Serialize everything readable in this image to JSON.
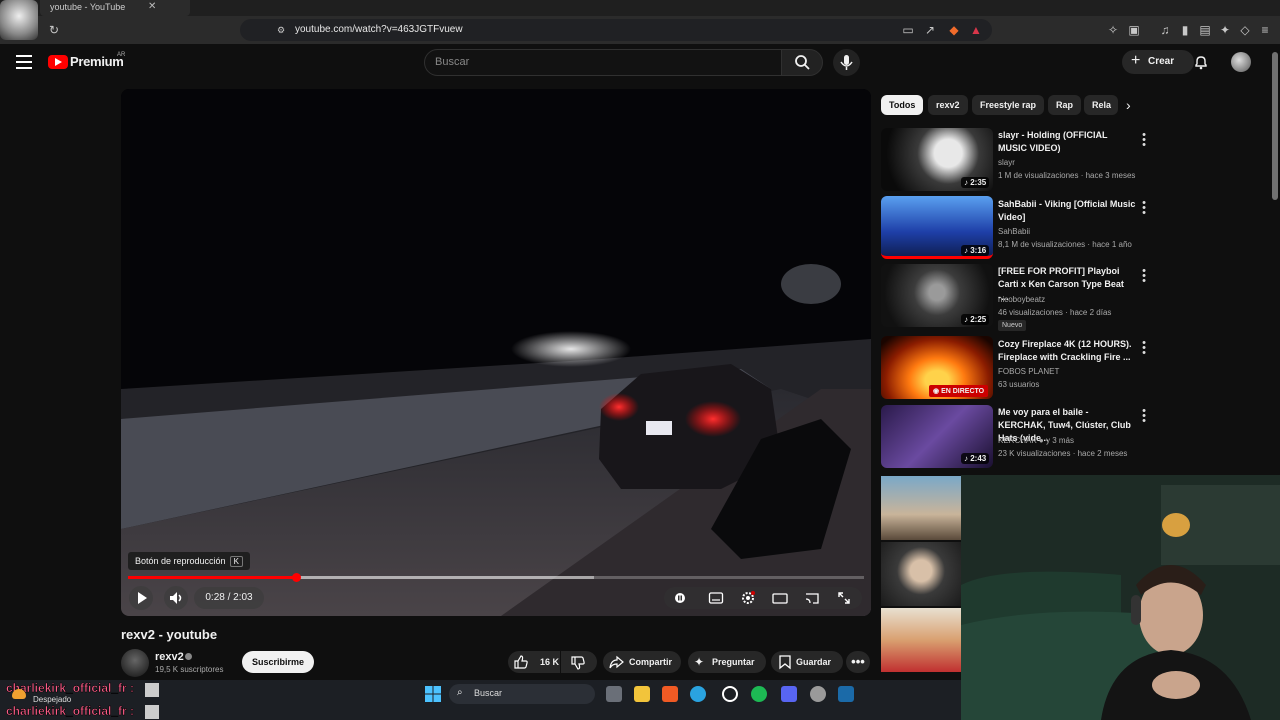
{
  "browser": {
    "tab_title": "youtube - YouTube",
    "url": "youtube.com/watch?v=463JGTFvuew"
  },
  "header": {
    "logo_text": "Premium",
    "logo_region": "AR",
    "search_placeholder": "Buscar",
    "create_label": "Crear"
  },
  "player": {
    "tooltip_label": "Botón de reproducción",
    "tooltip_key": "K",
    "time_display": "0:28 / 2:03",
    "progress_fraction": 0.228,
    "buffered_fraction": 0.633
  },
  "video": {
    "title": "rexv2 - youtube",
    "channel": "rexv2",
    "subscribers": "19,5 K suscriptores",
    "subscribe_label": "Suscribirme",
    "likes": "16 K",
    "share_label": "Compartir",
    "ask_label": "Preguntar",
    "save_label": "Guardar"
  },
  "chips": [
    "Todos",
    "rexv2",
    "Freestyle rap",
    "Rap",
    "Rela"
  ],
  "recommendations": [
    {
      "title": "slayr - Holding (OFFICIAL MUSIC VIDEO)",
      "channel": "slayr",
      "meta": "1 M de visualizaciones · hace 3 meses",
      "duration": "2:35"
    },
    {
      "title": "SahBabii - Viking [Official Music Video]",
      "channel": "SahBabii",
      "meta": "8,1 M de visualizaciones · hace 1 año",
      "duration": "3:16"
    },
    {
      "title": "[FREE FOR PROFIT] Playboi Carti x Ken Carson Type Beat -...",
      "channel": "nicoboybeatz",
      "meta": "46 visualizaciones · hace 2 días",
      "duration": "2:25",
      "badge": "Nuevo"
    },
    {
      "title": "Cozy Fireplace 4K (12 HOURS). Fireplace with Crackling Fire ...",
      "channel": "FOBOS PLANET",
      "meta": "63 usuarios",
      "live_label": "EN DIRECTO"
    },
    {
      "title": "Me voy para el baile - KERCHAK, Tuw4, Clúster, Club Hats (vide...",
      "channel": "KERCHAK",
      "channel_extra": "y 3 más",
      "meta": "23 K visualizaciones · hace 2 meses",
      "duration": "2:43"
    }
  ],
  "overlay": {
    "chat_user_1": "charliekirk_official_fr :",
    "chat_user_2": "charliekirk_official_fr :",
    "weather_text": "Despejado",
    "taskbar_search": "Buscar"
  },
  "colors": {
    "accent_red": "#ff0000",
    "background": "#0f0f0f",
    "chat_name": "#ff5e8a"
  }
}
